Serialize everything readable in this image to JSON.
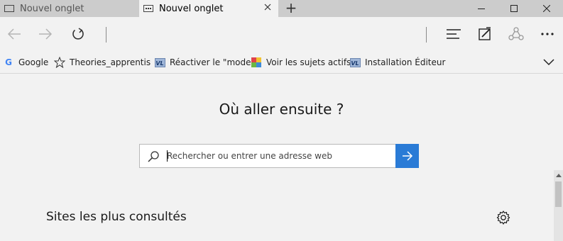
{
  "tabs": [
    {
      "label": "Nouvel onglet",
      "active": false
    },
    {
      "label": "Nouvel onglet",
      "active": true
    }
  ],
  "new_tab_glyph": "+",
  "window_controls": {
    "minimize": "minimize-icon",
    "maximize": "maximize-icon",
    "close": "close-icon"
  },
  "nav": {
    "back": "back-arrow-icon",
    "forward": "forward-arrow-icon",
    "refresh": "refresh-icon"
  },
  "toolbar_icons": [
    "hub-icon",
    "web-note-icon",
    "share-icon",
    "more-icon"
  ],
  "favorites": [
    {
      "label": "Google",
      "icon": "google-icon"
    },
    {
      "label": "Theories_apprentis",
      "icon": "star-icon"
    },
    {
      "label": "Réactiver le \"mode",
      "icon": "vlc-icon"
    },
    {
      "label": "Voir les sujets actifs",
      "icon": "colorful-icon"
    },
    {
      "label": "Installation Éditeur",
      "icon": "vlc-icon"
    }
  ],
  "vlc_badge": "VL",
  "main": {
    "heading": "Où aller ensuite ?",
    "search_placeholder": "Rechercher ou entrer une adresse web",
    "top_sites_title": "Sites les plus consultés"
  },
  "colors": {
    "accent": "#2a7bd6",
    "tabbar": "#cccccc",
    "background": "#f2f2f2"
  }
}
